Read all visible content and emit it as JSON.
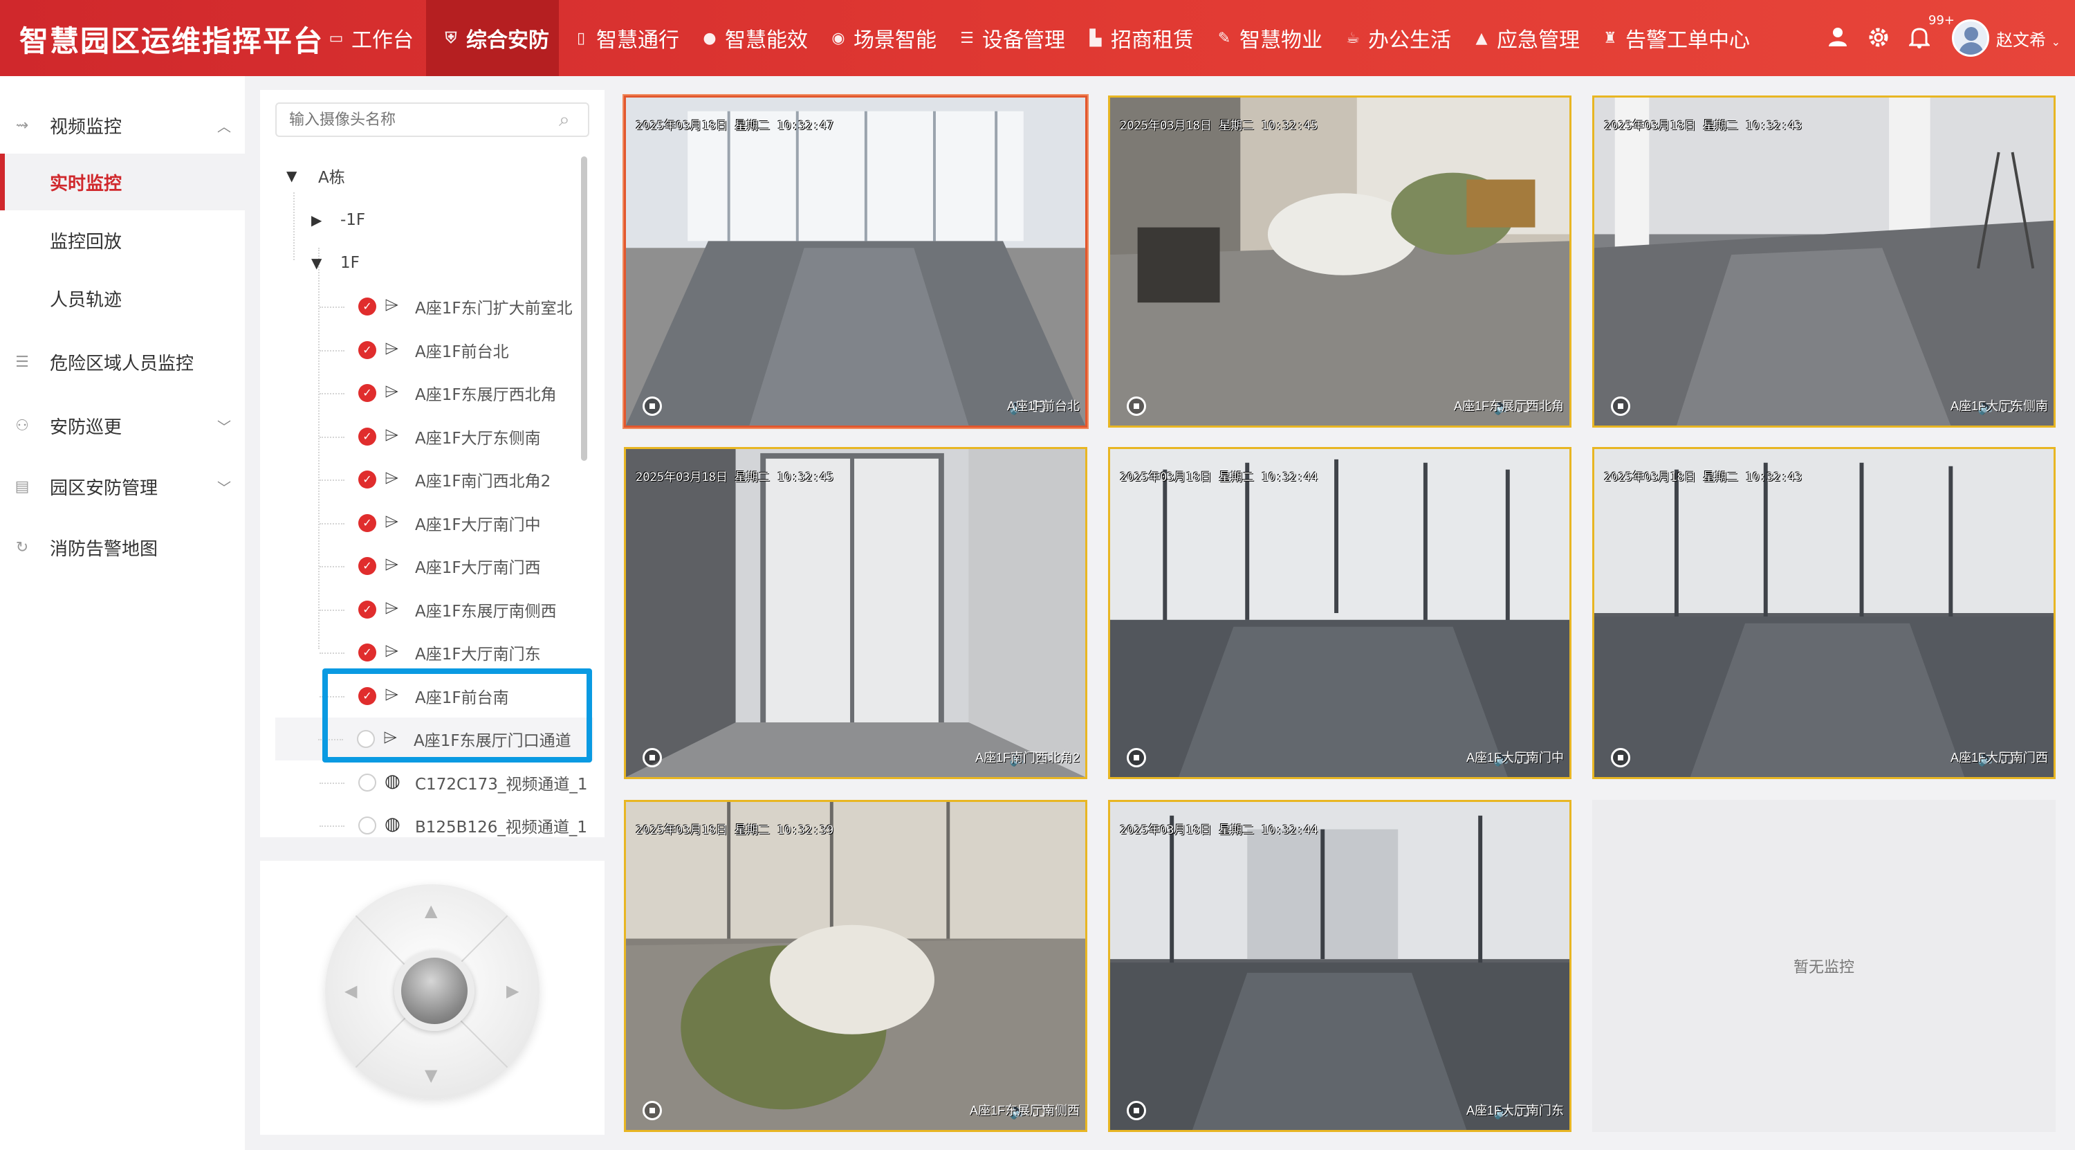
{
  "app": {
    "title": "智慧园区运维指挥平台"
  },
  "nav": {
    "items": [
      {
        "label": "工作台",
        "icon": "monitor-icon"
      },
      {
        "label": "综合安防",
        "icon": "shield-icon",
        "active": true
      },
      {
        "label": "智慧通行",
        "icon": "door-icon"
      },
      {
        "label": "智慧能效",
        "icon": "drop-icon"
      },
      {
        "label": "场景智能",
        "icon": "scene-icon"
      },
      {
        "label": "设备管理",
        "icon": "device-icon"
      },
      {
        "label": "招商租赁",
        "icon": "building-icon"
      },
      {
        "label": "智慧物业",
        "icon": "wrench-icon"
      },
      {
        "label": "办公生活",
        "icon": "cup-icon"
      },
      {
        "label": "应急管理",
        "icon": "warning-icon"
      },
      {
        "label": "告警工单中心",
        "icon": "alarm-icon"
      }
    ]
  },
  "user": {
    "name": "赵文希",
    "notification_count": "99+"
  },
  "sidebar": {
    "items": [
      {
        "label": "视频监控",
        "icon": "video-icon",
        "expanded": true
      },
      {
        "label": "实时监控",
        "active": true
      },
      {
        "label": "监控回放"
      },
      {
        "label": "人员轨迹"
      },
      {
        "label": "危险区域人员监控",
        "icon": "sliders-icon"
      },
      {
        "label": "安防巡更",
        "icon": "patrol-icon"
      },
      {
        "label": "园区安防管理",
        "icon": "calendar-icon"
      },
      {
        "label": "消防告警地图",
        "icon": "refresh-icon"
      }
    ]
  },
  "tree": {
    "search_placeholder": "输入摄像头名称",
    "root": "A栋",
    "floors": [
      "-1F",
      "1F"
    ],
    "cameras": [
      {
        "name": "A座1F东门扩大前室北",
        "online": true,
        "type": "gun"
      },
      {
        "name": "A座1F前台北",
        "online": true,
        "type": "gun"
      },
      {
        "name": "A座1F东展厅西北角",
        "online": true,
        "type": "gun"
      },
      {
        "name": "A座1F大厅东侧南",
        "online": true,
        "type": "gun"
      },
      {
        "name": "A座1F南门西北角2",
        "online": true,
        "type": "gun"
      },
      {
        "name": "A座1F大厅南门中",
        "online": true,
        "type": "gun"
      },
      {
        "name": "A座1F大厅南门西",
        "online": true,
        "type": "gun"
      },
      {
        "name": "A座1F东展厅南侧西",
        "online": true,
        "type": "gun"
      },
      {
        "name": "A座1F大厅南门东",
        "online": true,
        "type": "gun"
      },
      {
        "name": "A座1F前台南",
        "online": true,
        "type": "gun"
      },
      {
        "name": "A座1F东展厅门口通道",
        "online": false,
        "type": "gun"
      },
      {
        "name": "C172C173_视频通道_1",
        "online": false,
        "type": "dome"
      },
      {
        "name": "B125B126_视频通道_1",
        "online": false,
        "type": "dome"
      }
    ]
  },
  "tiles": [
    {
      "timestamp": "2025年03月18日 星期二 10:32:47",
      "caption": "A座1F前台北",
      "selected": true
    },
    {
      "timestamp": "2025年03月18日 星期二 10:32:45",
      "caption": "A座1F东展厅西北角"
    },
    {
      "timestamp": "2025年03月18日 星期二 10:32:43",
      "caption": "A座1F大厅东侧南"
    },
    {
      "timestamp": "2025年03月18日 星期二 10:32:45",
      "caption": "A座1F南门西北角2"
    },
    {
      "timestamp": "2025年03月18日 星期二 10:32:44",
      "caption": "A座1F大厅南门中"
    },
    {
      "timestamp": "2025年03月18日 星期二 10:32:43",
      "caption": "A座1F大厅南门西"
    },
    {
      "timestamp": "2025年03月18日 星期二 10:32:39",
      "caption": "A座1F东展厅南侧西"
    },
    {
      "timestamp": "2025年03月18日 星期二 10:32:44",
      "caption": "A座1F大厅南门东"
    },
    {
      "empty_text": "暂无监控"
    }
  ]
}
